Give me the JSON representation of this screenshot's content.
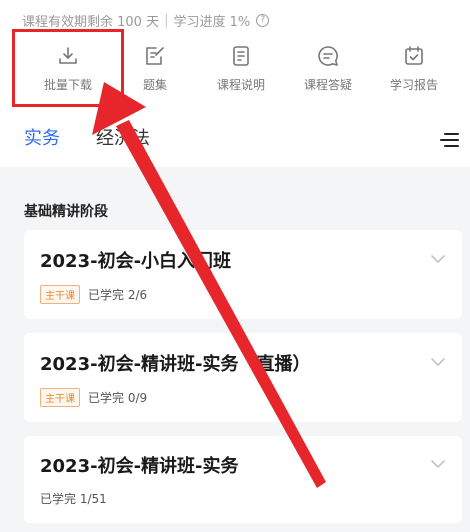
{
  "info": {
    "validity": "课程有效期剩余 100 天",
    "separator": "|",
    "progress": "学习进度 1%",
    "help_glyph": "?"
  },
  "toolbar": {
    "items": [
      {
        "label": "批量下载",
        "icon": "download-icon"
      },
      {
        "label": "题集",
        "icon": "edit-icon"
      },
      {
        "label": "课程说明",
        "icon": "document-icon"
      },
      {
        "label": "课程答疑",
        "icon": "chat-icon"
      },
      {
        "label": "学习报告",
        "icon": "calendar-check-icon"
      }
    ]
  },
  "tabs": {
    "items": [
      {
        "label": "实务",
        "active": true
      },
      {
        "label": "经济法",
        "active": false
      }
    ],
    "menu_icon": "list-menu-icon"
  },
  "section": {
    "title": "基础精讲阶段"
  },
  "courses": [
    {
      "title": "2023-初会-小白入门班",
      "tag": "主干课",
      "progress": "已学完 2/6"
    },
    {
      "title": "2023-初会-精讲班-实务（直播）",
      "tag": "主干课",
      "progress": "已学完 0/9"
    },
    {
      "title": "2023-初会-精讲班-实务",
      "tag": "",
      "progress": "已学完 1/51"
    }
  ],
  "colors": {
    "accent": "#2f6cf5",
    "highlight": "#e6262b",
    "tag": "#e58a2e",
    "background": "#f4f5f7"
  }
}
